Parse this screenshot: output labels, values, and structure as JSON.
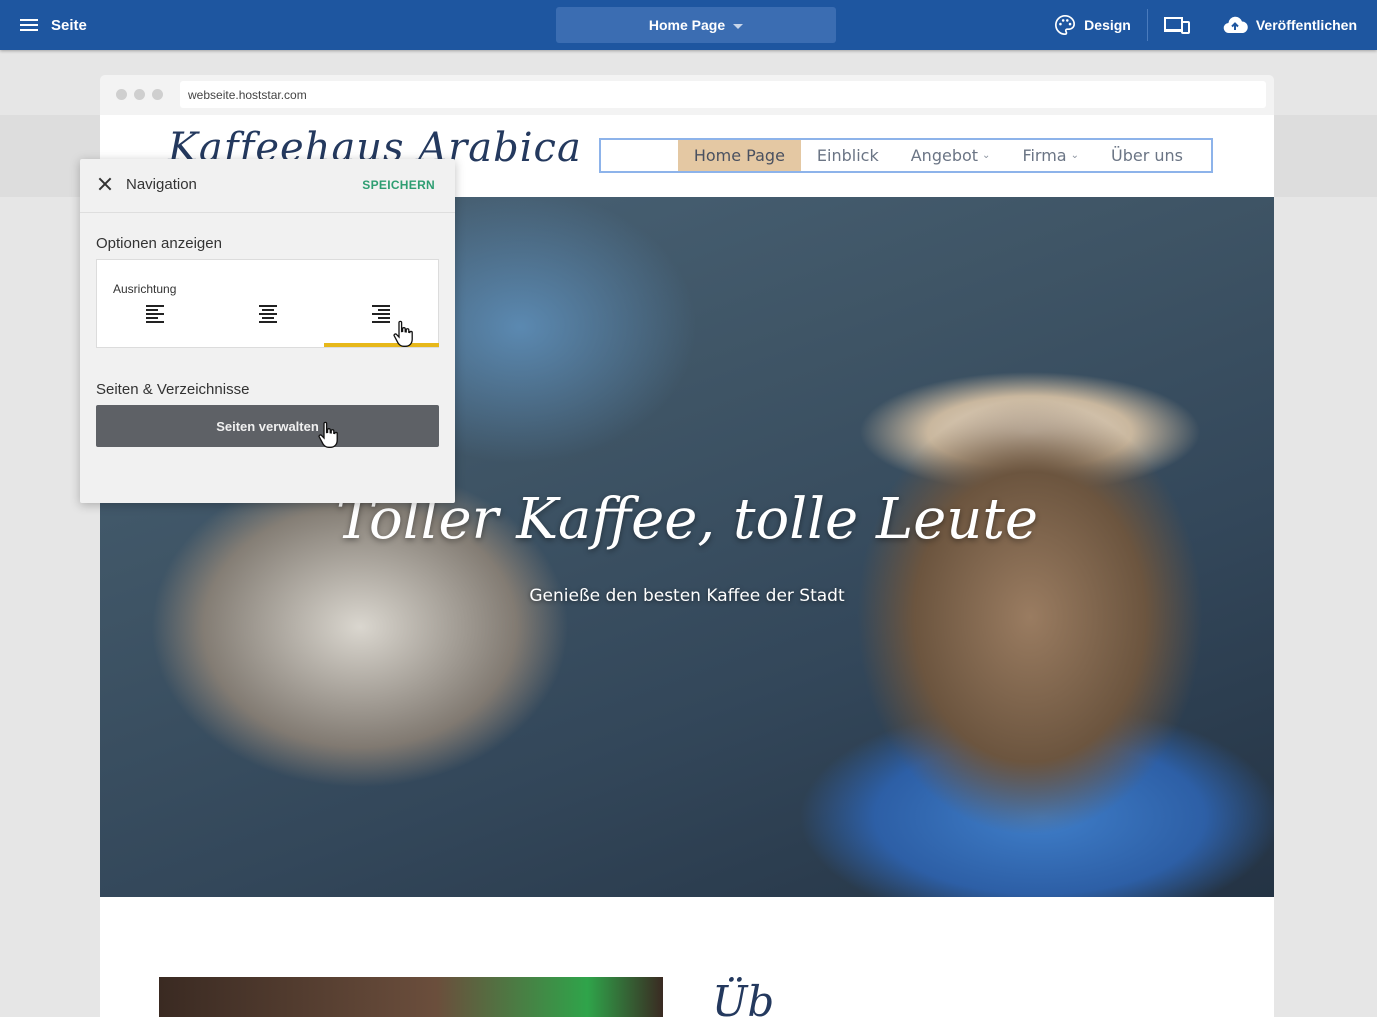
{
  "topbar": {
    "menu_label": "Seite",
    "current_page": "Home Page",
    "design_label": "Design",
    "publish_label": "Veröffentlichen"
  },
  "browser": {
    "url": "webseite.hoststar.com"
  },
  "site": {
    "logo_text": "Kaffeehaus Arabica",
    "nav": [
      "Home Page",
      "Einblick",
      "Angebot",
      "Firma",
      "Über uns"
    ],
    "hero_title": "Toller Kaffee, tolle Leute",
    "hero_subtitle": "Genieße den besten Kaffee der Stadt",
    "section_heading_partial": "Üb"
  },
  "panel": {
    "title": "Navigation",
    "save_label": "SPEICHERN",
    "options_title": "Optionen anzeigen",
    "alignment_label": "Ausrichtung",
    "alignment_selected": "right",
    "pages_title": "Seiten & Verzeichnisse",
    "manage_button": "Seiten verwalten"
  },
  "colors": {
    "topbar": "#1e56a0",
    "active_nav": "#e4c8a3",
    "save_accent": "#2e9e72",
    "selected_underline": "#e7b81a"
  }
}
